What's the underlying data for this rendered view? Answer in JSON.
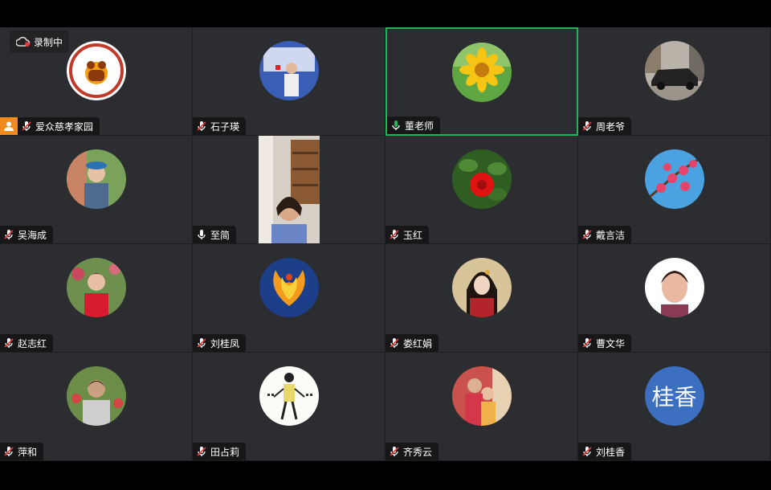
{
  "recording": {
    "label": "录制中",
    "icon": "cloud-record-icon"
  },
  "participants": [
    {
      "name": "爱众慈孝家园",
      "mic": "muted",
      "host": true,
      "avatar": "logo-image"
    },
    {
      "name": "石子瑛",
      "mic": "muted",
      "avatar": "photo-presenter"
    },
    {
      "name": "董老师",
      "mic": "active",
      "avatar": "photo-sunflower",
      "speaking": true
    },
    {
      "name": "周老爷",
      "mic": "muted",
      "avatar": "photo-car"
    },
    {
      "name": "吴海成",
      "mic": "muted",
      "avatar": "photo-man-hat"
    },
    {
      "name": "至简",
      "mic": "unmuted",
      "video": true
    },
    {
      "name": "玉红",
      "mic": "muted",
      "avatar": "photo-red-flower"
    },
    {
      "name": "戴言洁",
      "mic": "muted",
      "avatar": "photo-blossom"
    },
    {
      "name": "赵志红",
      "mic": "muted",
      "avatar": "photo-woman-red"
    },
    {
      "name": "刘桂凤",
      "mic": "muted",
      "avatar": "photo-phoenix"
    },
    {
      "name": "娄红娟",
      "mic": "muted",
      "avatar": "photo-costume-lady"
    },
    {
      "name": "曹文华",
      "mic": "muted",
      "avatar": "photo-elderly-woman"
    },
    {
      "name": "萍和",
      "mic": "muted",
      "avatar": "photo-woman-garden"
    },
    {
      "name": "田占莉",
      "mic": "muted",
      "avatar": "photo-calligraphy-figure"
    },
    {
      "name": "齐秀云",
      "mic": "muted",
      "avatar": "photo-grandma-child"
    },
    {
      "name": "刘桂香",
      "mic": "muted",
      "avatar_text": "桂香"
    }
  ],
  "colors": {
    "tile": "#2b2d31",
    "speaking_border": "#1fb755",
    "host_badge": "#f28a1d",
    "muted": "#e33b3b",
    "text_avatar": "#3d6fc1"
  }
}
